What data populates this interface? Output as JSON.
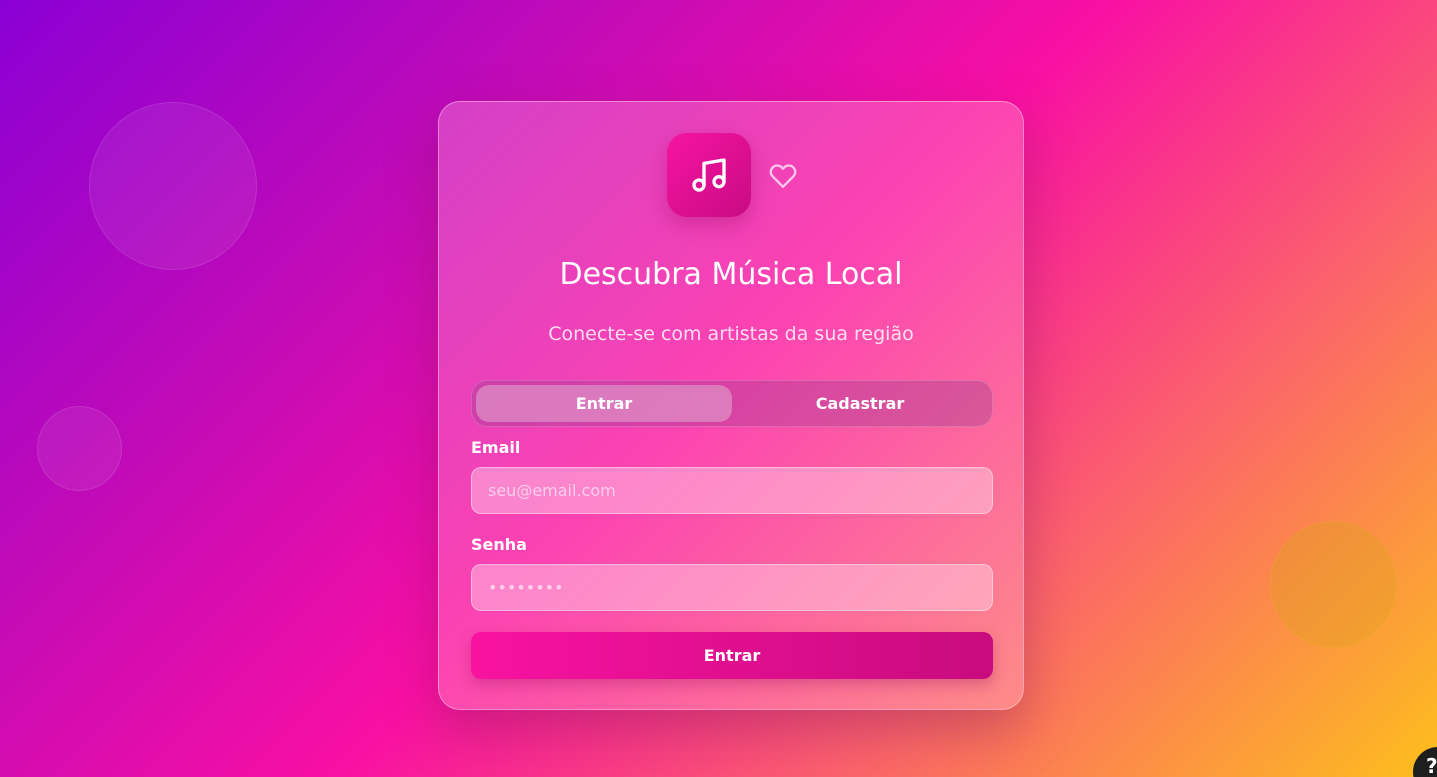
{
  "icons": {
    "logo": "music-note-icon",
    "favorite": "heart-icon",
    "help": "question-mark-icon"
  },
  "colors": {
    "accent": "#f614a0",
    "accent_dark": "#c80b84"
  },
  "card": {
    "title": "Descubra Música Local",
    "subtitle": "Conecte-se com artistas da sua região",
    "tabs": [
      {
        "label": "Entrar",
        "active": true
      },
      {
        "label": "Cadastrar",
        "active": false
      }
    ],
    "email": {
      "label": "Email",
      "placeholder": "seu@email.com",
      "value": ""
    },
    "senha": {
      "label": "Senha",
      "placeholder": "••••••••",
      "value": ""
    },
    "submit_label": "Entrar"
  },
  "help_button": {
    "label": "?"
  }
}
